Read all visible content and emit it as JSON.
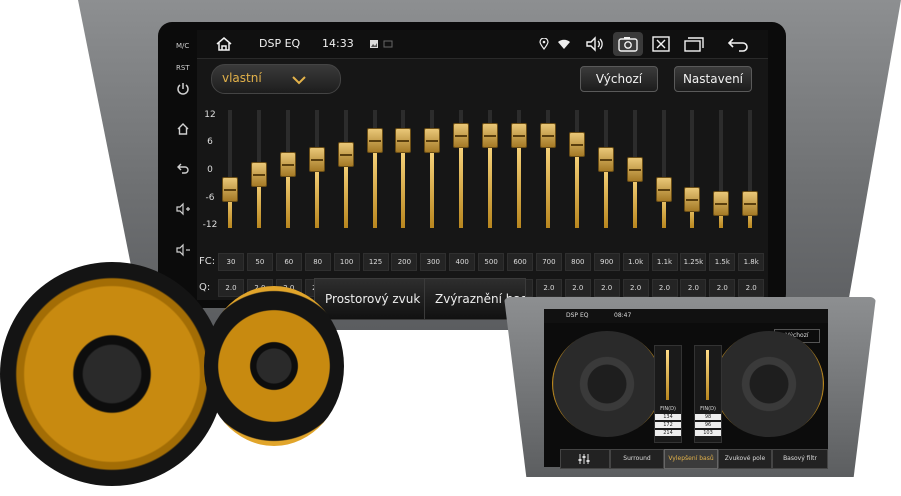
{
  "side_buttons": [
    {
      "label": "M/C",
      "icon": "mic-icon"
    },
    {
      "label": "RST",
      "icon": "reset-icon"
    }
  ],
  "side_icons": [
    "power-icon",
    "home-icon",
    "back-icon",
    "volume-up-icon",
    "volume-down-icon"
  ],
  "status": {
    "title": "DSP EQ",
    "time": "14:33",
    "icons": [
      "home-icon",
      "image-icon",
      "location-icon",
      "wifi-icon",
      "volume-icon",
      "screenshot-icon",
      "close-window-icon",
      "recent-apps-icon",
      "back-icon"
    ]
  },
  "preset": {
    "label": "vlastní",
    "icon": "chevron-down-icon"
  },
  "buttons": {
    "default": "Výchozí",
    "settings": "Nastavení"
  },
  "db_scale": [
    "12",
    "6",
    "0",
    "-6",
    "-12"
  ],
  "fc_label": "FC:",
  "q_label": "Q:",
  "bands": [
    {
      "fc": "30",
      "q": "2.0",
      "gain": -4
    },
    {
      "fc": "50",
      "q": "2.0",
      "gain": -1
    },
    {
      "fc": "60",
      "q": "2.0",
      "gain": 1
    },
    {
      "fc": "80",
      "q": "2.0",
      "gain": 2
    },
    {
      "fc": "100",
      "q": "2.0",
      "gain": 3
    },
    {
      "fc": "125",
      "q": "2.0",
      "gain": 6
    },
    {
      "fc": "200",
      "q": "2.0",
      "gain": 6
    },
    {
      "fc": "300",
      "q": "2.0",
      "gain": 6
    },
    {
      "fc": "400",
      "q": "2.0",
      "gain": 7
    },
    {
      "fc": "500",
      "q": "2.0",
      "gain": 7
    },
    {
      "fc": "600",
      "q": "2.0",
      "gain": 7
    },
    {
      "fc": "700",
      "q": "2.0",
      "gain": 7
    },
    {
      "fc": "800",
      "q": "2.0",
      "gain": 5
    },
    {
      "fc": "900",
      "q": "2.0",
      "gain": 2
    },
    {
      "fc": "1.0k",
      "q": "2.0",
      "gain": 0
    },
    {
      "fc": "1.1k",
      "q": "2.0",
      "gain": -4
    },
    {
      "fc": "1.25k",
      "q": "2.0",
      "gain": -6
    },
    {
      "fc": "1.5k",
      "q": "2.0",
      "gain": -7
    },
    {
      "fc": "1.8k",
      "q": "2.0",
      "gain": -7
    }
  ],
  "modes": {
    "surround": "Prostorový zvuk",
    "bass_boost": "Zvýraznění bas"
  },
  "inset": {
    "title": "DSP EQ",
    "time": "08:47",
    "default": "Výchozí",
    "tabs": [
      "Surround",
      "Vylepšení basů",
      "Zvukové pole",
      "Basový filtr"
    ],
    "left_panel": {
      "label": "FIN(D)",
      "values": [
        "134",
        "172",
        "214"
      ]
    },
    "right_panel": {
      "label": "FIN(D)",
      "values": [
        "98",
        "96",
        "103"
      ]
    }
  },
  "colors": {
    "accent_gold": "#e3b24a",
    "screen_bg": "#161616",
    "bezel": "#7a7c7e"
  }
}
